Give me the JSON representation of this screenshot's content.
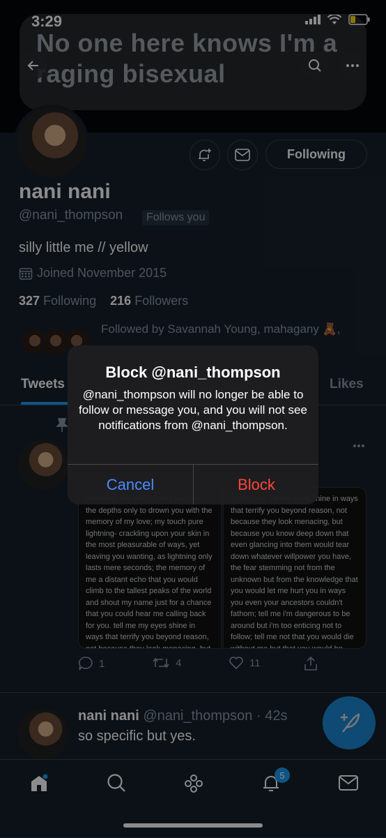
{
  "status_bar": {
    "time": "3:29"
  },
  "header": {
    "banner_text": "No one here knows I'm a raging bisexual"
  },
  "profile": {
    "display_name": "nani nani",
    "handle": "@nani_thompson",
    "follows_you": "Follows you",
    "bio": "silly little me // yellow",
    "joined": "Joined November 2015",
    "following_count": "327",
    "following_label": "Following",
    "followers_count": "216",
    "followers_label": "Followers",
    "followed_by": "Followed by Savannah Young, mahagany 🧸,",
    "follow_button": "Following"
  },
  "tabs": [
    {
      "label": "Tweets"
    },
    {
      "label": "Likes"
    }
  ],
  "tweet1": {
    "poem_left": "shoreline; my voice luring you into the depths only to drown you with the memory of my love; my touch pure lightning- crackling upon your skin in the most pleasurable of ways, yet leaving you wanting, as lightning only lasts mere seconds; the memory of me a distant echo that you would climb to the tallest peaks of the world and shout my name just for a chance that you could hear me calling back for you. tell me my eyes shine in ways that terrify you beyond reason, not because they look menacing, but because you know deep down that even glancing into them would tear down whatever willpower you",
    "poem_right": "could hear me my eyes shine in ways that terrify you beyond reason, not because they look menacing, but because you know deep down that even glancing into them would tear down whatever willpower you have, the fear stemming not from the unknown but from the knowledge that you would let me hurt you in ways you even your ancestors couldn't fathom; tell me i'm dangerous to be around but i'm too enticing not to follow; tell me not that you would die without me but that you would be afraid of never having lived were you not to stay in my orbit. fuck man, write poetry for me.",
    "replies": "1",
    "retweets": "4",
    "likes": "11"
  },
  "tweet2": {
    "name": "nani nani",
    "handle_time": "@nani_thompson · 42s",
    "text": "so specific but yes."
  },
  "bottom_nav": {
    "notification_badge": "5"
  },
  "alert": {
    "title": "Block @nani_thompson",
    "message": "@nani_thompson will no longer be able to follow or message you, and you will not see notifications from @nani_thompson.",
    "cancel": "Cancel",
    "confirm": "Block"
  },
  "colors": {
    "accent": "#1d9bf0",
    "destructive": "#ff453a",
    "cancel": "#4a8cff"
  }
}
